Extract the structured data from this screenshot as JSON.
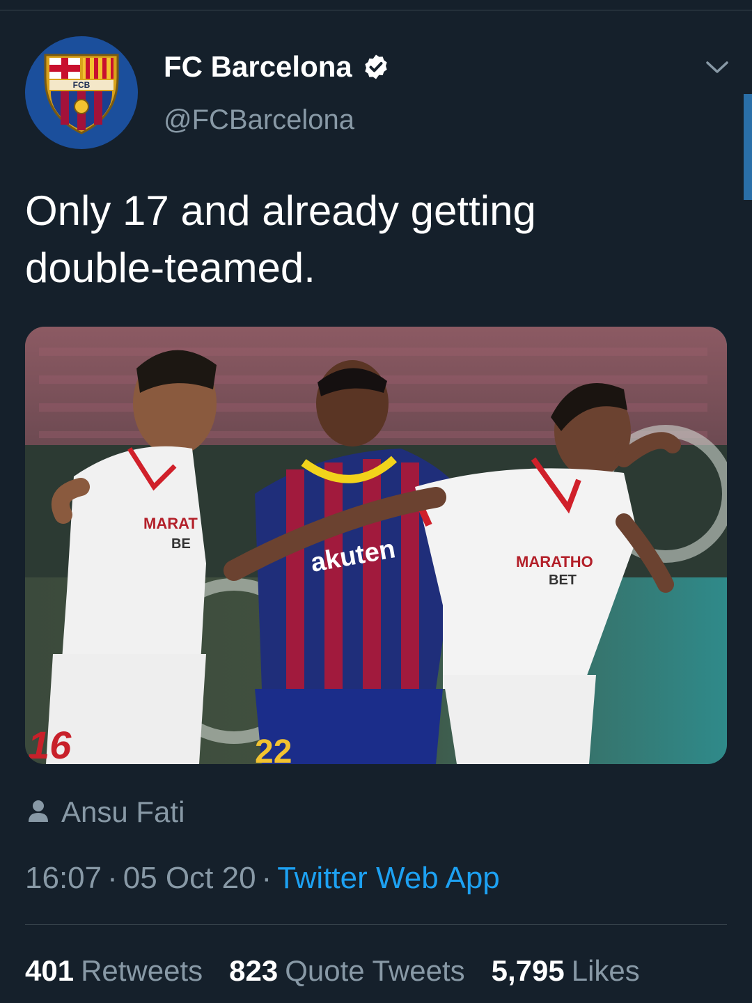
{
  "tweet": {
    "author": {
      "display_name": "FC Barcelona",
      "handle": "@FCBarcelona",
      "verified": true,
      "avatar_icon": "fc-barcelona-crest-icon",
      "avatar_text": "FCB"
    },
    "text": "Only 17 and already getting\ndouble-teamed.",
    "media": {
      "icon": "football-match-photo",
      "image_text": [
        "MARAT",
        "BE",
        "akuten",
        "MARATHO",
        "BET",
        "16",
        "22"
      ]
    },
    "tag": {
      "icon": "person-icon",
      "label": "Ansu Fati"
    },
    "meta": {
      "time": "16:07",
      "date": "05 Oct 20",
      "separator": "·",
      "source": "Twitter Web App"
    },
    "stats": {
      "retweets_count": "401",
      "retweets_label": "Retweets",
      "quotes_count": "823",
      "quotes_label": "Quote Tweets",
      "likes_count": "5,795",
      "likes_label": "Likes"
    }
  },
  "colors": {
    "background": "#15202b",
    "secondary_text": "#8899a6",
    "link": "#1da1f2",
    "divider": "#38444d"
  },
  "icons": {
    "verified": "verified-badge-icon",
    "menu": "chevron-down-icon"
  }
}
